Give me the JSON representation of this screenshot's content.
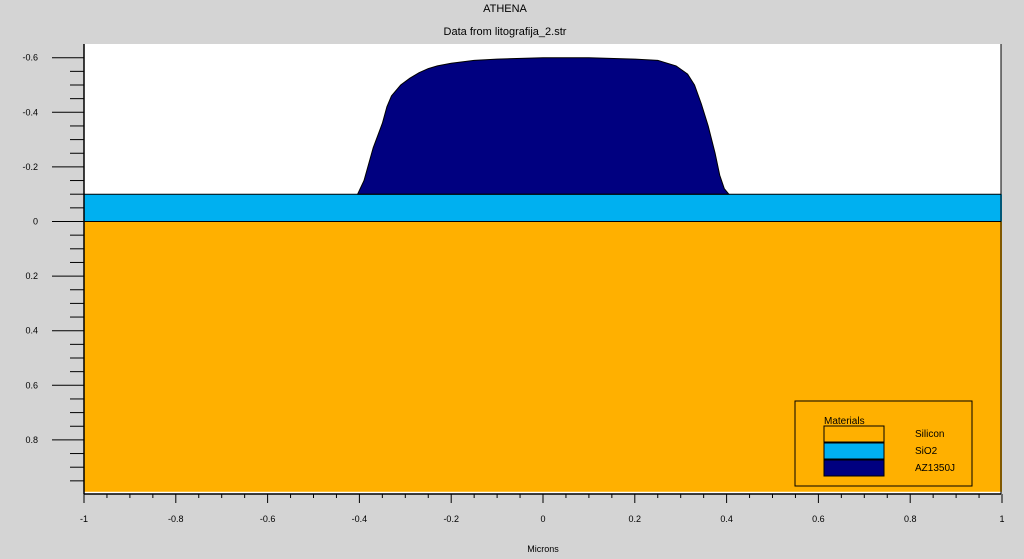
{
  "header": {
    "title": "ATHENA",
    "subtitle": "Data from litografija_2.str"
  },
  "chart_data": {
    "type": "area",
    "title": "ATHENA",
    "subtitle": "Data from litografija_2.str",
    "xlabel": "Microns",
    "ylabel": "",
    "xlim": [
      -1,
      1
    ],
    "ylim": [
      -0.6,
      0.99
    ],
    "y_inverted": true,
    "x_ticks": [
      -1,
      -0.8,
      -0.6,
      -0.4,
      -0.2,
      0,
      0.2,
      0.4,
      0.6,
      0.8,
      1
    ],
    "x_tick_labels": [
      "-1",
      "-0.8",
      "-0.6",
      "-0.4",
      "-0.2",
      "0",
      "0.2",
      "0.4",
      "0.6",
      "0.8",
      "1"
    ],
    "y_ticks": [
      -0.6,
      -0.4,
      -0.2,
      0,
      0.2,
      0.4,
      0.6,
      0.8
    ],
    "y_tick_labels": [
      "-0.6",
      "-0.4",
      "-0.2",
      "0",
      "0.2",
      "0.4",
      "0.6",
      "0.8"
    ],
    "grid": false,
    "legend_position": "bottom-right",
    "legend_title": "Materials",
    "series": [
      {
        "name": "Silicon",
        "color": "#ffb000",
        "region": {
          "x": [
            -1,
            1
          ],
          "y_top": 0,
          "y_bottom": 0.99
        }
      },
      {
        "name": "SiO2",
        "color": "#00b0f0",
        "region": {
          "x": [
            -1,
            1
          ],
          "y_top": -0.1,
          "y_bottom": 0
        }
      },
      {
        "name": "AZ1350J",
        "color": "#000080",
        "profile": {
          "x": [
            -0.404,
            -0.39,
            -0.37,
            -0.35,
            -0.34,
            -0.33,
            -0.31,
            -0.29,
            -0.27,
            -0.25,
            -0.23,
            -0.2,
            -0.15,
            -0.1,
            0,
            0.1,
            0.2,
            0.25,
            0.29,
            0.315,
            0.33,
            0.345,
            0.36,
            0.375,
            0.385,
            0.395,
            0.405
          ],
          "y": [
            -0.1,
            -0.15,
            -0.27,
            -0.36,
            -0.42,
            -0.46,
            -0.5,
            -0.525,
            -0.545,
            -0.56,
            -0.57,
            -0.58,
            -0.59,
            -0.595,
            -0.6,
            -0.6,
            -0.595,
            -0.59,
            -0.57,
            -0.54,
            -0.5,
            -0.43,
            -0.35,
            -0.25,
            -0.17,
            -0.12,
            -0.1
          ]
        }
      }
    ]
  }
}
